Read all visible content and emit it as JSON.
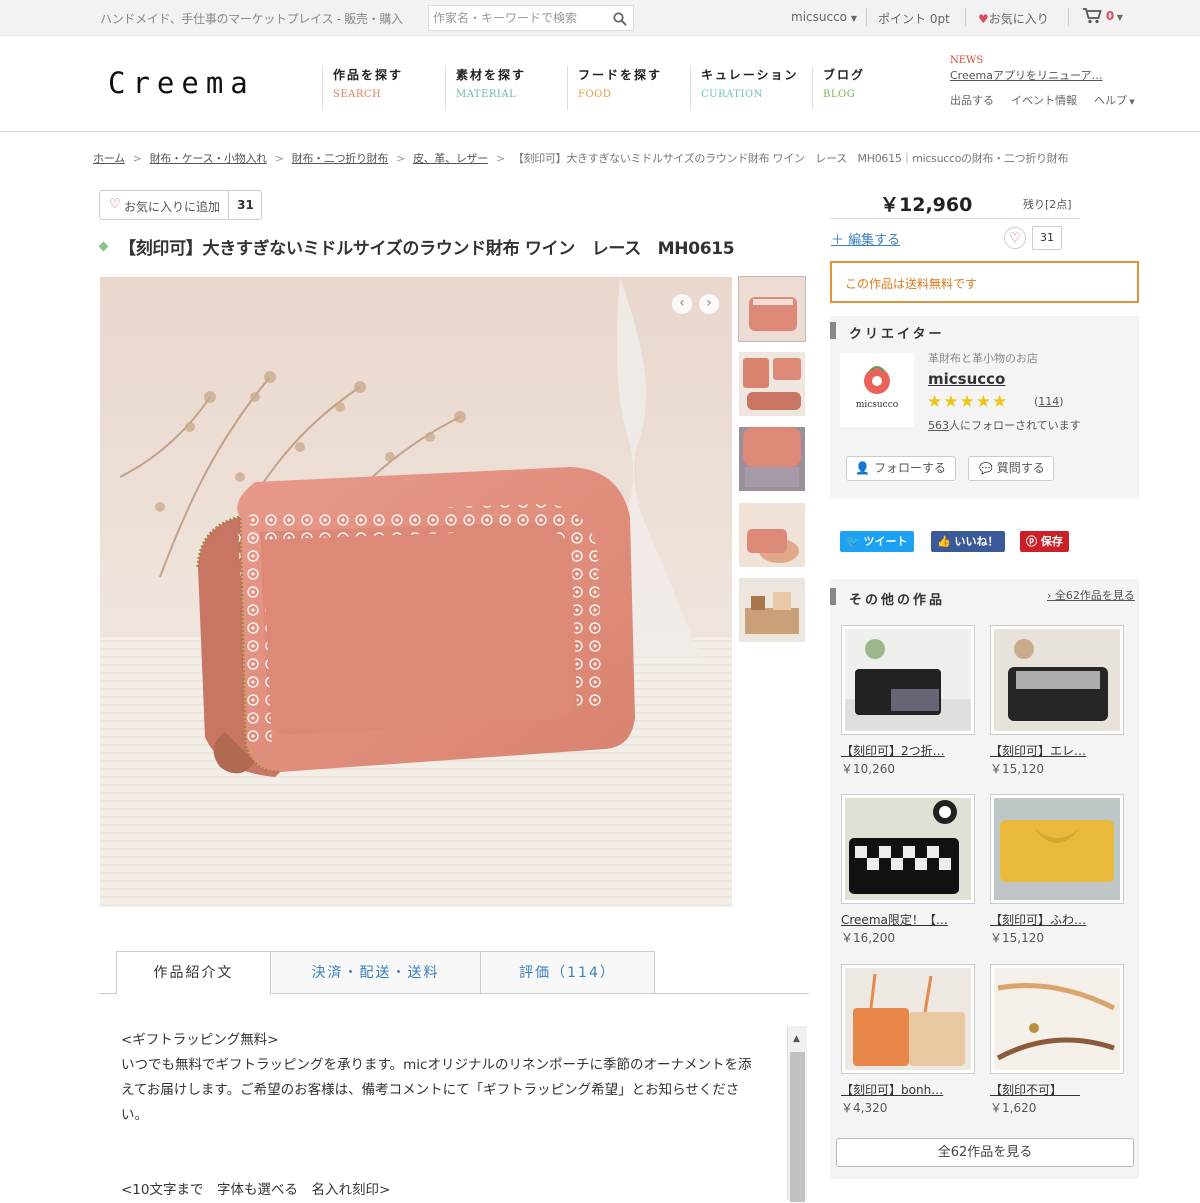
{
  "topbar": {
    "tagline": "ハンドメイド、手仕事のマーケットプレイス - 販売・購入",
    "search_placeholder": "作家名・キーワードで検索",
    "user": "micsucco",
    "points": "ポイント 0pt",
    "favorites": "お気に入り",
    "cart_count": "0"
  },
  "header": {
    "logo": "Creema",
    "nav": [
      {
        "jp": "作品を探す",
        "en": "SEARCH",
        "color": "#e8785a"
      },
      {
        "jp": "素材を探す",
        "en": "MATERIAL",
        "color": "#6bb3a8"
      },
      {
        "jp": "フードを探す",
        "en": "FOOD",
        "color": "#e89a3c"
      },
      {
        "jp": "キュレーション",
        "en": "CURATION",
        "color": "#6bc3c8"
      },
      {
        "jp": "ブログ",
        "en": "BLOG",
        "color": "#7ab34a"
      }
    ],
    "news_label": "NEWS",
    "news_text": "Creemaアプリをリニューア…",
    "links": [
      "出品する",
      "イベント情報",
      "ヘルプ"
    ]
  },
  "breadcrumb": {
    "items": [
      "ホーム",
      "財布・ケース・小物入れ",
      "財布・二つ折り財布",
      "皮、革、レザー"
    ],
    "current": "【刻印可】大きすぎないミドルサイズのラウンド財布 ワイン　レース　MH0615｜micsuccoの財布・二つ折り財布"
  },
  "product": {
    "fav_label": "お気に入りに追加",
    "fav_count": "31",
    "title": "【刻印可】大きすぎないミドルサイズのラウンド財布 ワイン　レース　MH0615",
    "tabs": [
      "作品紹介文",
      "決済・配送・送料",
      "評価（114）"
    ],
    "description": [
      "<ギフトラッピング無料>",
      "いつでも無料でギフトラッピングを承ります。micオリジナルのリネンポーチに季節のオーナメントを添えてお届けします。ご希望のお客様は、備考コメントにて「ギフトラッピング希望」とお知らせください。",
      "",
      "",
      "<10文字まで　字体も選べる　名入れ刻印>"
    ]
  },
  "sidebar": {
    "price": "￥12,960",
    "remain": "残り[2点]",
    "edit": "＋ 編集する",
    "fav_count": "31",
    "free_shipping": "この作品は送料無料です",
    "creator_heading": "クリエイター",
    "creator_tagline": "革財布と革小物のお店",
    "creator_name": "micsucco",
    "avatar_text": "micsucco",
    "rating_count": "114",
    "followers_count": "563",
    "followers_text": "人にフォローされています",
    "follow_btn": "フォローする",
    "question_btn": "質問する",
    "social": {
      "tweet": "ツイート",
      "like": "いいね！",
      "save": "保存"
    },
    "other_heading": "その他の作品",
    "see_all_link": "全62作品を見る",
    "see_all_button": "全62作品を見る",
    "products": [
      {
        "name": "【刻印可】2つ折…",
        "price": "￥10,260"
      },
      {
        "name": "【刻印可】エレ…",
        "price": "￥15,120"
      },
      {
        "name": "Creema限定！【…",
        "price": "￥16,200"
      },
      {
        "name": "【刻印可】ふわ…",
        "price": "￥15,120"
      },
      {
        "name": "【刻印可】bonh…",
        "price": "￥4,320"
      },
      {
        "name": "【刻印不可】　　",
        "price": "￥1,620"
      }
    ]
  }
}
